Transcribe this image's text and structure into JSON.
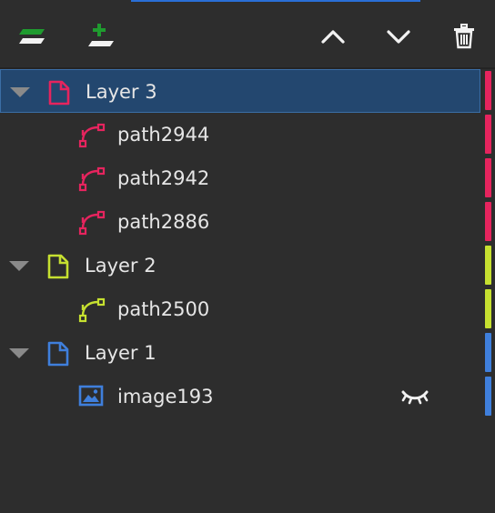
{
  "colors": {
    "layer3": "#e6245e",
    "layer2": "#c6e030",
    "layer1": "#3f7fdc",
    "selection": "#23476f",
    "background": "#2d2d2d"
  },
  "toolbar": {
    "icons": [
      "add-layer-icon",
      "add-sublayer-icon",
      "move-up-icon",
      "move-down-icon",
      "trash-icon"
    ]
  },
  "tree": [
    {
      "kind": "layer",
      "label": "Layer 3",
      "color": "layer3",
      "selected": true,
      "expanded": true
    },
    {
      "kind": "path",
      "label": "path2944",
      "color": "layer3"
    },
    {
      "kind": "path",
      "label": "path2942",
      "color": "layer3"
    },
    {
      "kind": "path",
      "label": "path2886",
      "color": "layer3"
    },
    {
      "kind": "layer",
      "label": "Layer 2",
      "color": "layer2",
      "expanded": true
    },
    {
      "kind": "path",
      "label": "path2500",
      "color": "layer2"
    },
    {
      "kind": "layer",
      "label": "Layer 1",
      "color": "layer1",
      "expanded": true
    },
    {
      "kind": "image",
      "label": "image193",
      "color": "layer1",
      "hidden": true
    }
  ]
}
